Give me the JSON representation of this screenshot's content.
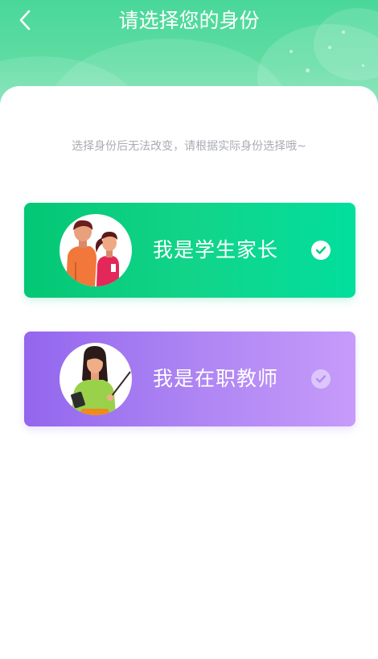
{
  "header": {
    "title": "请选择您的身份",
    "back_icon": "chevron-left-icon"
  },
  "hint": "选择身份后无法改变，请根据实际身份选择哦~",
  "roles": [
    {
      "label": "我是学生家长",
      "avatar_icon": "parent-child-avatar",
      "selected": true,
      "gradient": [
        "#03c774",
        "#02de9d"
      ]
    },
    {
      "label": "我是在职教师",
      "avatar_icon": "teacher-avatar",
      "selected": false,
      "gradient": [
        "#9366ee",
        "#c69bfa"
      ]
    }
  ],
  "colors": {
    "header_green": "#49d89a",
    "hint_text": "#a9acb3"
  }
}
